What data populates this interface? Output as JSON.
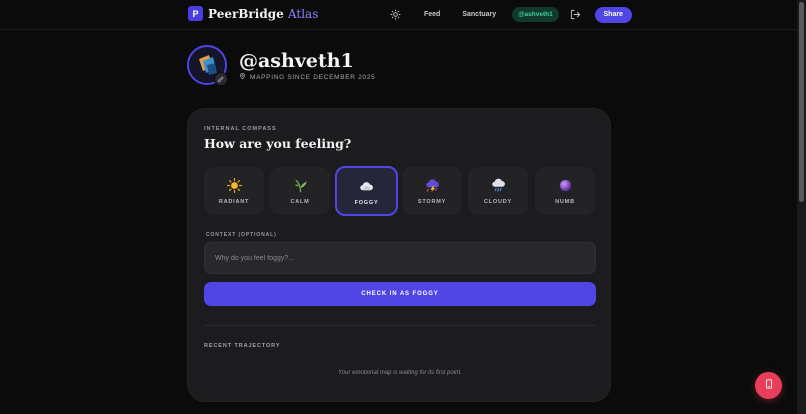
{
  "app": {
    "logo_letter": "P",
    "brand_primary": "PeerBridge",
    "brand_accent": "Atlas"
  },
  "nav": {
    "feed": "Feed",
    "sanctuary": "Sanctuary",
    "user_pill": "@ashveth1",
    "share": "Share"
  },
  "profile": {
    "handle": "@ashveth1",
    "since": "MAPPING SINCE DECEMBER 2025"
  },
  "compass": {
    "eyebrow": "INTERNAL COMPASS",
    "question": "How are you feeling?",
    "moods": [
      {
        "label": "RADIANT",
        "icon": "sun-icon"
      },
      {
        "label": "CALM",
        "icon": "leaf-icon"
      },
      {
        "label": "FOGGY",
        "icon": "cloud-icon",
        "selected": true
      },
      {
        "label": "STORMY",
        "icon": "storm-cloud-icon"
      },
      {
        "label": "CLOUDY",
        "icon": "rain-cloud-icon"
      },
      {
        "label": "NUMB",
        "icon": "purple-orb-icon"
      }
    ],
    "context_label": "CONTEXT (OPTIONAL)",
    "context_placeholder": "Why do you feel foggy?...",
    "context_value": "",
    "checkin_button": "CHECK IN AS FOGGY"
  },
  "trajectory": {
    "label": "RECENT TRAJECTORY",
    "empty_message": "Your emotional map is waiting for its first point."
  },
  "colors": {
    "accent": "#4f46e5",
    "brand_accent": "#8b84ff",
    "user_pill_text": "#3fd19a",
    "fab": "#e83e5a",
    "card": "#1c1c1e"
  }
}
